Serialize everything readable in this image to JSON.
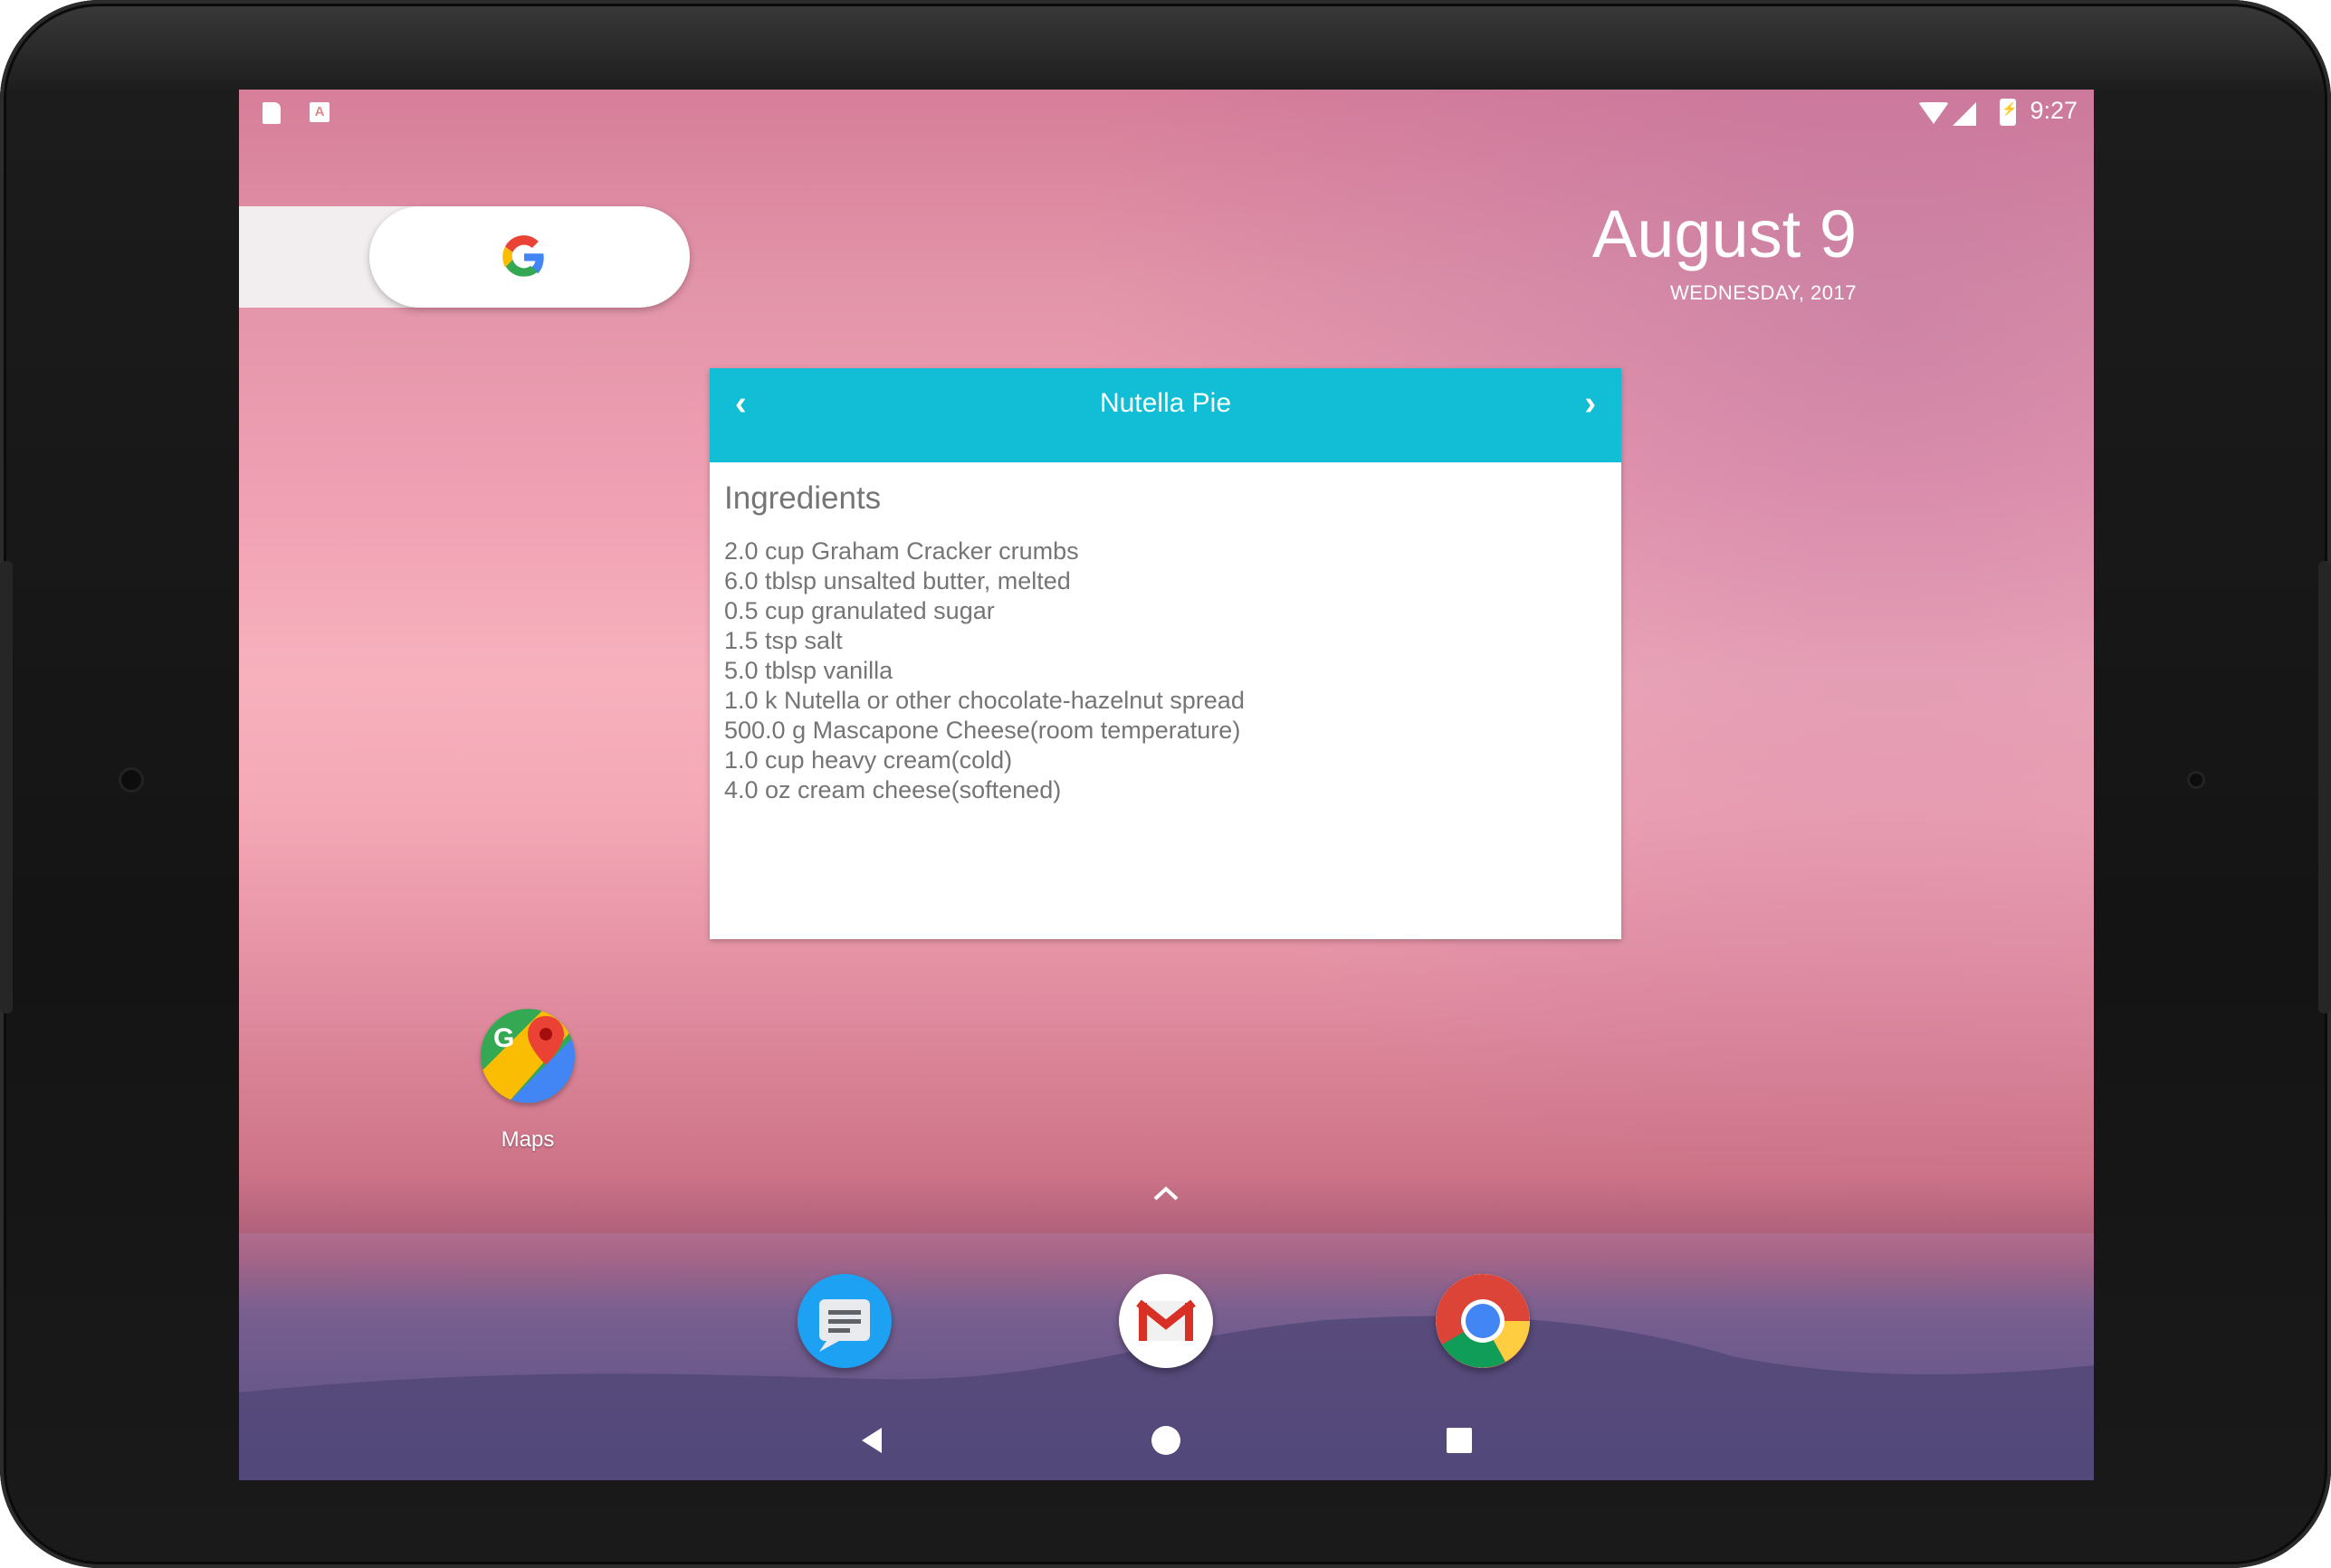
{
  "status_bar": {
    "time": "9:27"
  },
  "date_widget": {
    "date": "August 9",
    "weekday_year": "WEDNESDAY, 2017"
  },
  "recipe_widget": {
    "title": "Nutella Pie",
    "prev_arrow": "‹",
    "next_arrow": "›",
    "heading": "Ingredients",
    "ingredients": [
      "2.0 cup Graham Cracker crumbs",
      "6.0 tblsp unsalted butter, melted",
      "0.5 cup granulated sugar",
      "1.5 tsp salt",
      "5.0 tblsp vanilla",
      "1.0 k Nutella or other chocolate-hazelnut spread",
      "500.0 g Mascapone Cheese(room temperature)",
      "1.0 cup heavy cream(cold)",
      "4.0 oz cream cheese(softened)"
    ],
    "header_color": "#12bed5"
  },
  "home_apps": [
    {
      "label": "Maps",
      "icon": "maps-icon"
    }
  ],
  "dock_apps": [
    {
      "icon": "messages-icon"
    },
    {
      "icon": "gmail-icon"
    },
    {
      "icon": "chrome-icon"
    }
  ],
  "nav_bar": {
    "icons": [
      "back-icon",
      "home-icon",
      "recents-icon"
    ]
  }
}
